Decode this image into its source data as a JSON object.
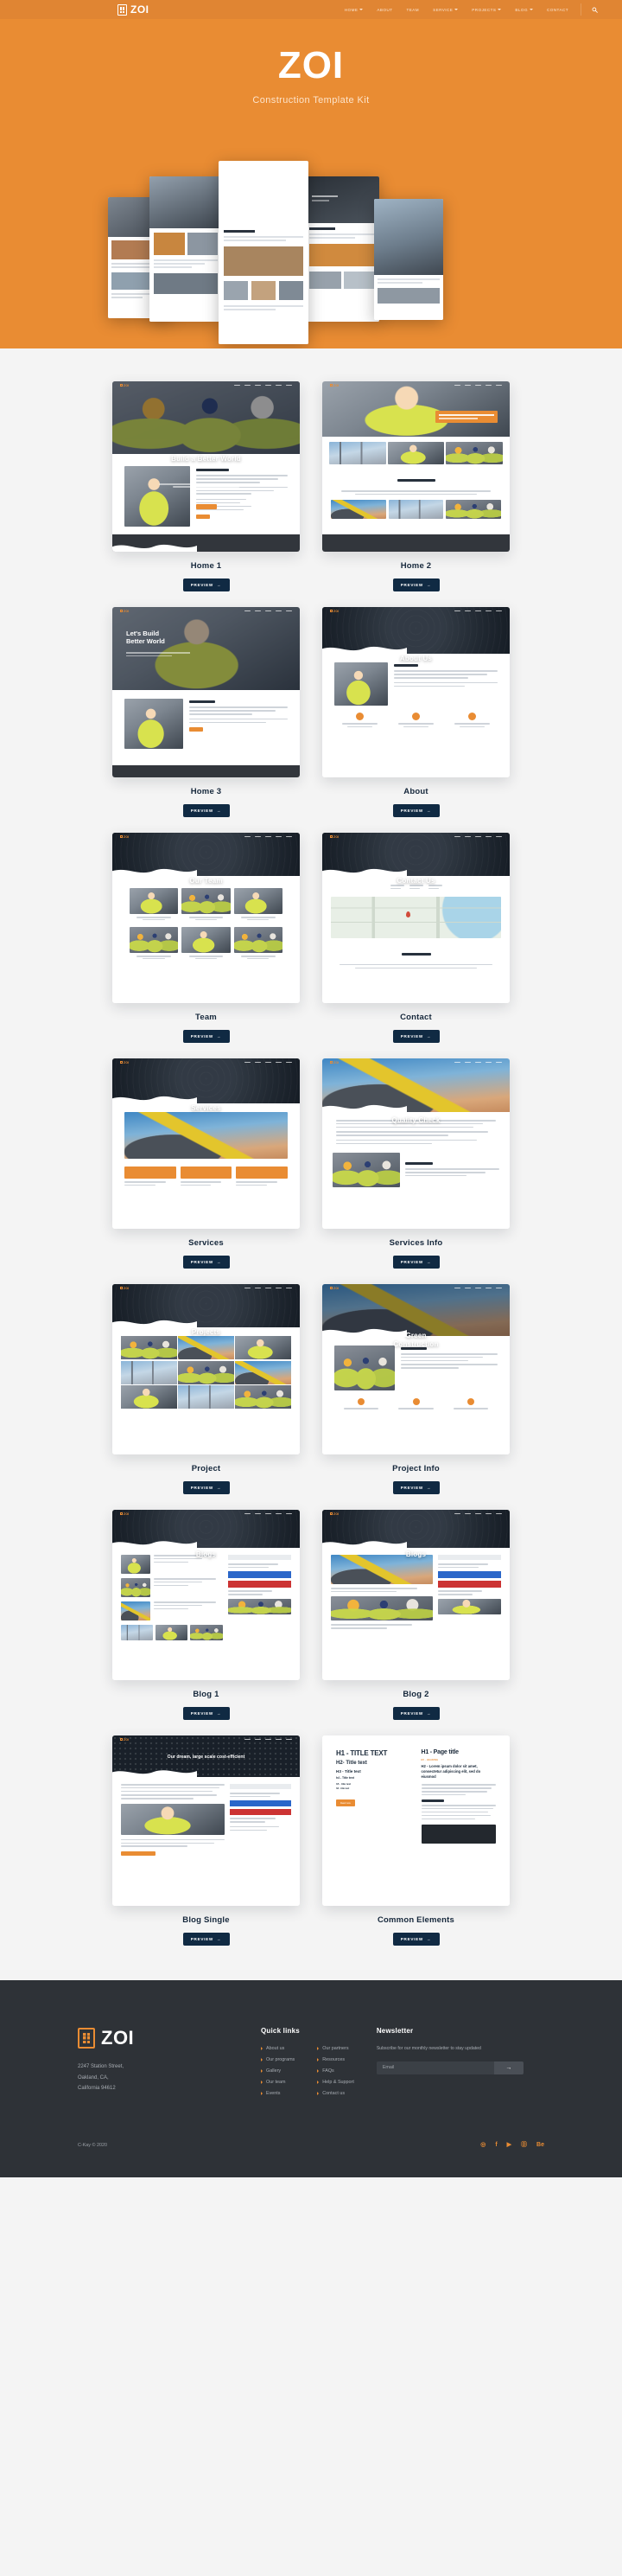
{
  "header": {
    "brand": "ZOI",
    "brand_icon": "building-icon",
    "nav": [
      {
        "label": "HOME",
        "has_dropdown": true
      },
      {
        "label": "ABOUT",
        "has_dropdown": false
      },
      {
        "label": "TEAM",
        "has_dropdown": false
      },
      {
        "label": "SERVICE",
        "has_dropdown": true
      },
      {
        "label": "PROJECTS",
        "has_dropdown": true
      },
      {
        "label": "BLOG",
        "has_dropdown": true
      },
      {
        "label": "CONTACT",
        "has_dropdown": false
      }
    ],
    "search_icon": "search-icon",
    "bg_color": "#e08533"
  },
  "hero": {
    "title": "ZOI",
    "subtitle": "Construction Template Kit",
    "bg_color": "#e98c33"
  },
  "grid": {
    "preview_label": "PREVIEW",
    "preview_arrow": "→",
    "cards": [
      {
        "label": "Home 1",
        "hero_title": "Build a Better World",
        "section_title": "About us"
      },
      {
        "label": "Home 2",
        "hero_title": "",
        "section_title": "Working Pattern"
      },
      {
        "label": "Home 3",
        "hero_title": "Let's Build\nBetter World",
        "section_title": "About us"
      },
      {
        "label": "About",
        "hero_title": "About Us",
        "section_title": "About us"
      },
      {
        "label": "Team",
        "hero_title": "Our Team",
        "section_title": ""
      },
      {
        "label": "Contact",
        "hero_title": "Contact Us",
        "section_title": "Drop Us A Line"
      },
      {
        "label": "Services",
        "hero_title": "Services",
        "section_title": ""
      },
      {
        "label": "Services Info",
        "hero_title": "Quality Check",
        "section_title": "Green Construction"
      },
      {
        "label": "Project",
        "hero_title": "Projects",
        "section_title": ""
      },
      {
        "label": "Project Info",
        "hero_title": "Green\nConstruction",
        "section_title": "Project Info"
      },
      {
        "label": "Blog 1",
        "hero_title": "Blogs",
        "section_title": ""
      },
      {
        "label": "Blog 2",
        "hero_title": "Blogs",
        "section_title": ""
      },
      {
        "label": "Blog Single",
        "hero_title": "Our dream, large scale cost-efficient",
        "section_title": ""
      },
      {
        "label": "Common Elements",
        "hero_title": "",
        "section_title": ""
      }
    ],
    "common_elements": {
      "left": {
        "h1": "H1 - TITLE TEXT",
        "h2": "H2- Title text",
        "h3": "H3 - Title text",
        "h4": "h4 - Title text",
        "h5": "h5 - title text",
        "h6": "h6 - title text",
        "button": "Read more"
      },
      "right": {
        "h1": "H1 - Page title",
        "eyebrow": "H5 - HEADING",
        "h2": "H2 - Lorem ipsum dolor sit amet, consectetur adipiscing elit, sed do eiusmod",
        "h3": "H3 - Content title"
      }
    }
  },
  "footer": {
    "brand": "ZOI",
    "brand_icon": "building-icon",
    "address": "2247  Station Street,\nOakland, CA,\nCalifornia 94612",
    "quick_links_title": "Quick links",
    "quick_links_col1": [
      "About us",
      "Our programs",
      "Gallery",
      "Our team",
      "Events"
    ],
    "quick_links_col2": [
      "Our partners",
      "Resources",
      "FAQs",
      "Help & Support",
      "Contact us"
    ],
    "newsletter_title": "Newsletter",
    "newsletter_sub": "Subscribe for our monthly newsletter to stay updated",
    "email_placeholder": "Email",
    "email_value": "",
    "submit_arrow": "→",
    "copyright": "C-Kay © 2020",
    "socials": [
      {
        "name": "instagram-icon",
        "glyph": "◎"
      },
      {
        "name": "facebook-icon",
        "glyph": "f"
      },
      {
        "name": "youtube-icon",
        "glyph": "▶"
      },
      {
        "name": "dribbble-icon",
        "glyph": "Ⓓ"
      },
      {
        "name": "behance-icon",
        "glyph": "Be"
      }
    ],
    "bg_color": "#2e3237",
    "accent_color": "#e98c33"
  }
}
